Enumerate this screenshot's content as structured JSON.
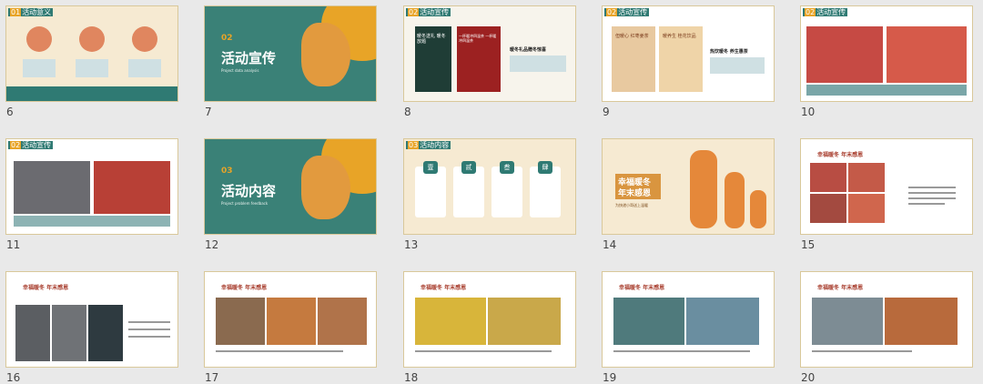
{
  "slides": [
    {
      "number": "6",
      "tag_num": "01",
      "tag_text": "活动意义"
    },
    {
      "number": "7",
      "title": "活动宣传",
      "title_num": "02",
      "subtitle": "Project data analysis"
    },
    {
      "number": "8",
      "tag_num": "02",
      "tag_text": "活动宣传",
      "text1": "暖冬送礼 暖冬放题",
      "text2": "一杯暖冲四温茶 一杯暖冲四温茶",
      "heading": "暖冬礼品赠冬惊喜"
    },
    {
      "number": "9",
      "tag_num": "02",
      "tag_text": "活动宣传",
      "text1": "但暖心 红枣姜茶",
      "text2": "暖养生 桂花饮品",
      "heading": "热饮暖冬 养生惠茶"
    },
    {
      "number": "10",
      "tag_num": "02",
      "tag_text": "活动宣传"
    },
    {
      "number": "11",
      "tag_num": "02",
      "tag_text": "活动宣传"
    },
    {
      "number": "12",
      "title": "活动内容",
      "title_num": "03",
      "subtitle": "Project problem feedback"
    },
    {
      "number": "13",
      "tag_num": "03",
      "tag_text": "活动内容",
      "cards": [
        "壹",
        "贰",
        "叁",
        "肆"
      ]
    },
    {
      "number": "14",
      "title1": "幸福暖冬",
      "title2": "年末感恩",
      "subtitle": "为快递小哥送上温暖"
    },
    {
      "number": "15",
      "header": "幸福暖冬 年末感恩"
    },
    {
      "number": "16",
      "header": "幸福暖冬 年末感恩"
    },
    {
      "number": "17",
      "header": "幸福暖冬 年末感恩"
    },
    {
      "number": "18",
      "header": "幸福暖冬 年末感恩"
    },
    {
      "number": "19",
      "header": "幸福暖冬 年末感恩"
    },
    {
      "number": "20",
      "header": "幸福暖冬 年末感恩"
    }
  ],
  "colors": {
    "teal": "#2f7a73",
    "cream": "#f6ead2",
    "gold": "#e8a427",
    "red": "#a73c2c"
  }
}
